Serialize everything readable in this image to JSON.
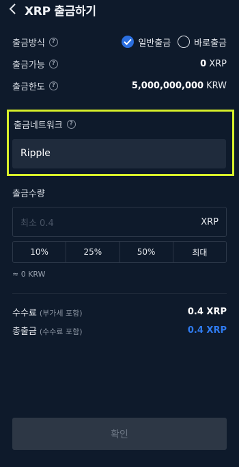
{
  "header": {
    "title": "XRP 출금하기"
  },
  "method": {
    "label": "출금방식",
    "options": [
      {
        "label": "일반출금",
        "checked": true
      },
      {
        "label": "바로출금",
        "checked": false
      }
    ]
  },
  "available": {
    "label": "출금가능",
    "amount": "0",
    "unit": "XRP"
  },
  "limit": {
    "label": "출금한도",
    "amount": "5,000,000,000",
    "unit": "KRW"
  },
  "network": {
    "label": "출금네트워크",
    "value": "Ripple"
  },
  "amount": {
    "label": "출금수량",
    "placeholder": "최소 0.4",
    "unit": "XRP",
    "presets": [
      "10%",
      "25%",
      "50%",
      "최대"
    ],
    "approx": "≈ 0 KRW"
  },
  "fee": {
    "label": "수수료",
    "note": "(부가세 포함)",
    "value": "0.4 XRP"
  },
  "total": {
    "label": "총출금",
    "note": "(수수료 포함)",
    "value": "0.4 XRP"
  },
  "confirm_label": "확인",
  "colors": {
    "accent": "#2b6fe0",
    "total_value": "#2f7bf0",
    "highlight_border": "#d7ef2a"
  },
  "icons": {
    "back": "chevron-left-icon",
    "help": "question-circle-icon",
    "check": "check-icon"
  }
}
